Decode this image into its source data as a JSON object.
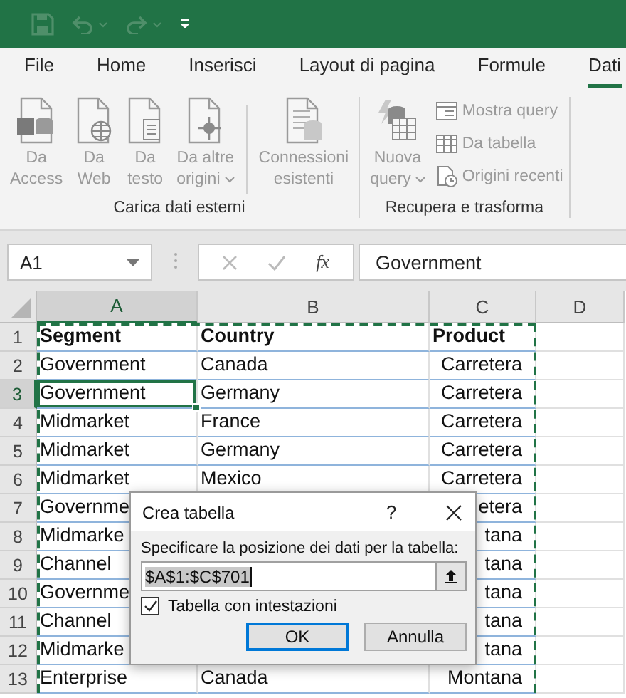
{
  "tabs": [
    {
      "label": "File",
      "selected": false
    },
    {
      "label": "Home",
      "selected": false
    },
    {
      "label": "Inserisci",
      "selected": false
    },
    {
      "label": "Layout di pagina",
      "selected": false
    },
    {
      "label": "Formule",
      "selected": false
    },
    {
      "label": "Dati",
      "selected": true
    }
  ],
  "ribbon": {
    "groups": [
      {
        "label": "Carica dati esterni",
        "items": [
          {
            "kind": "large",
            "lines": [
              "Da",
              "Access"
            ],
            "dropdown": false,
            "disabled": true
          },
          {
            "kind": "large",
            "lines": [
              "Da",
              "Web"
            ],
            "dropdown": false,
            "disabled": true
          },
          {
            "kind": "large",
            "lines": [
              "Da",
              "testo"
            ],
            "dropdown": false,
            "disabled": true
          },
          {
            "kind": "large",
            "lines": [
              "Da altre",
              "origini"
            ],
            "dropdown": true,
            "disabled": true
          },
          {
            "kind": "separator"
          },
          {
            "kind": "large",
            "lines": [
              "Connessioni",
              "esistenti"
            ],
            "dropdown": false,
            "disabled": true
          }
        ]
      },
      {
        "label": "Recupera e trasforma",
        "items": [
          {
            "kind": "large",
            "lines": [
              "Nuova",
              "query"
            ],
            "dropdown": true,
            "disabled": true
          },
          {
            "kind": "stack",
            "items": [
              {
                "label": "Mostra query",
                "disabled": true
              },
              {
                "label": "Da tabella",
                "disabled": true
              },
              {
                "label": "Origini recenti",
                "disabled": true
              }
            ]
          }
        ]
      }
    ]
  },
  "formula_bar": {
    "name_box": "A1",
    "function_label": "fx",
    "content": "Government"
  },
  "sheet": {
    "marquee": true,
    "columns": [
      {
        "label": "A",
        "selected": true
      },
      {
        "label": "B",
        "selected": false
      },
      {
        "label": "C",
        "selected": false
      },
      {
        "label": "D",
        "selected": false
      }
    ],
    "rows": [
      {
        "header": "1",
        "kind": "heading",
        "selected": false,
        "cells": [
          "Segment",
          "Country",
          "Product"
        ]
      },
      {
        "header": "2",
        "kind": "data",
        "selected": false,
        "cells": [
          "Government",
          "Canada",
          "Carretera"
        ]
      },
      {
        "header": "3",
        "kind": "data",
        "selected": true,
        "cells": [
          "Government",
          "Germany",
          "Carretera"
        ]
      },
      {
        "header": "4",
        "kind": "data",
        "selected": false,
        "cells": [
          "Midmarket",
          "France",
          "Carretera"
        ]
      },
      {
        "header": "5",
        "kind": "data",
        "selected": false,
        "cells": [
          "Midmarket",
          "Germany",
          "Carretera"
        ]
      },
      {
        "header": "6",
        "kind": "data",
        "selected": false,
        "cells": [
          "Midmarket",
          "Mexico",
          "Carretera"
        ]
      },
      {
        "header": "7",
        "kind": "data",
        "selected": false,
        "cells": [
          "Governme",
          null,
          "etera"
        ]
      },
      {
        "header": "8",
        "kind": "data",
        "selected": false,
        "cells": [
          "Midmarke",
          null,
          "tana"
        ]
      },
      {
        "header": "9",
        "kind": "data",
        "selected": false,
        "cells": [
          "Channel",
          null,
          "tana"
        ]
      },
      {
        "header": "10",
        "kind": "data",
        "selected": false,
        "cells": [
          "Governme",
          null,
          "tana"
        ]
      },
      {
        "header": "11",
        "kind": "data",
        "selected": false,
        "cells": [
          "Channel",
          null,
          "tana"
        ]
      },
      {
        "header": "12",
        "kind": "data",
        "selected": false,
        "cells": [
          "Midmarke",
          null,
          "tana"
        ]
      },
      {
        "header": "13",
        "kind": "data",
        "selected": false,
        "cells": [
          "Enterprise",
          "Canada",
          "Montana"
        ]
      }
    ]
  },
  "dialog": {
    "title": "Crea tabella",
    "help": "?",
    "prompt": "Specificare la posizione dei dati per la tabella:",
    "range": "$A$1:$C$701",
    "range_selected": true,
    "checkbox": {
      "label": "Tabella con intestazioni",
      "checked": true
    },
    "buttons": [
      {
        "label": "OK",
        "default": true
      },
      {
        "label": "Annulla",
        "default": false
      }
    ]
  }
}
